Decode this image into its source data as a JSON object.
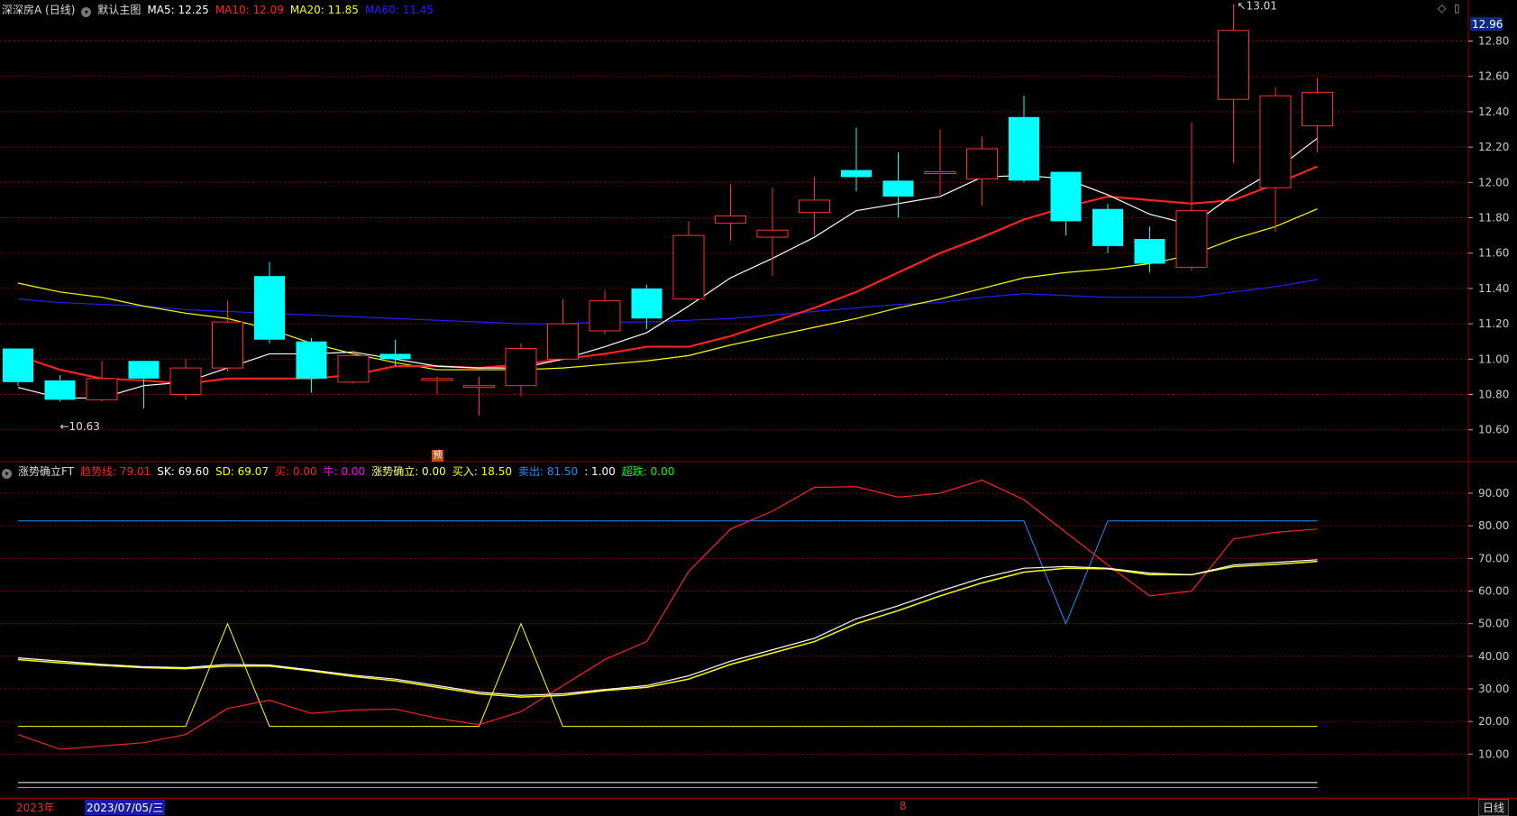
{
  "header": {
    "stock": "深深房A (日线)",
    "template": "默认主图",
    "ma": [
      {
        "label": "MA5: 12.25",
        "color": "#ffffff"
      },
      {
        "label": "MA10: 12.09",
        "color": "#ff2020"
      },
      {
        "label": "MA20: 11.85",
        "color": "#ffff00"
      },
      {
        "label": "MA60: 11.45",
        "color": "#2020ff"
      }
    ]
  },
  "indicator": {
    "name": "涨势确立FT",
    "items": [
      {
        "label": "趋势线: 79.01",
        "color": "#ff2020"
      },
      {
        "label": "SK: 69.60",
        "color": "#ffffff"
      },
      {
        "label": "SD: 69.07",
        "color": "#ffff00"
      },
      {
        "label": "买: 0.00",
        "color": "#ff2020"
      },
      {
        "label": "牛: 0.00",
        "color": "#ff00ff"
      },
      {
        "label": "涨势确立: 0.00",
        "color": "#ffff66"
      },
      {
        "label": "买入: 18.50",
        "color": "#ffff00"
      },
      {
        "label": "卖出: 81.50",
        "color": "#1e90ff"
      },
      {
        "label": ": 1.00",
        "color": "#ffffff"
      },
      {
        "label": "超跌: 0.00",
        "color": "#00ff00"
      }
    ]
  },
  "price_axis": {
    "ticks": [
      "12.80",
      "12.60",
      "12.40",
      "12.20",
      "12.00",
      "11.80",
      "11.60",
      "11.40",
      "11.20",
      "11.00",
      "10.80",
      "10.60"
    ],
    "current": "12.96",
    "high_label": "13.01",
    "low_label": "10.63"
  },
  "ind_axis": {
    "ticks": [
      "90.00",
      "80.00",
      "70.00",
      "60.00",
      "50.00",
      "40.00",
      "30.00",
      "20.00",
      "10.00"
    ]
  },
  "bottom": {
    "year": "2023年",
    "date": "2023/07/05/三",
    "month": "8",
    "period": "日线"
  },
  "marker": "预",
  "colors": {
    "up": "#ff3030",
    "down": "#00ffff",
    "grid": "#8b0000"
  },
  "chart_data": {
    "type": "candlestick",
    "candles": [
      {
        "o": 11.06,
        "h": 11.06,
        "l": 10.85,
        "c": 10.87
      },
      {
        "o": 10.88,
        "h": 10.91,
        "l": 10.76,
        "c": 10.77
      },
      {
        "o": 10.77,
        "h": 10.99,
        "l": 10.76,
        "c": 10.89
      },
      {
        "o": 10.99,
        "h": 10.99,
        "l": 10.72,
        "c": 10.89
      },
      {
        "o": 10.8,
        "h": 11.0,
        "l": 10.77,
        "c": 10.95
      },
      {
        "o": 10.95,
        "h": 11.33,
        "l": 10.93,
        "c": 11.21
      },
      {
        "o": 11.47,
        "h": 11.55,
        "l": 11.09,
        "c": 11.11
      },
      {
        "o": 11.1,
        "h": 11.12,
        "l": 10.81,
        "c": 10.89
      },
      {
        "o": 10.87,
        "h": 11.05,
        "l": 10.86,
        "c": 11.02
      },
      {
        "o": 11.03,
        "h": 11.11,
        "l": 10.96,
        "c": 11.0
      },
      {
        "o": 10.88,
        "h": 10.9,
        "l": 10.8,
        "c": 10.89
      },
      {
        "o": 10.84,
        "h": 10.9,
        "l": 10.68,
        "c": 10.85
      },
      {
        "o": 10.85,
        "h": 11.09,
        "l": 10.79,
        "c": 11.06
      },
      {
        "o": 11.0,
        "h": 11.34,
        "l": 11.0,
        "c": 11.2
      },
      {
        "o": 11.16,
        "h": 11.39,
        "l": 11.14,
        "c": 11.33
      },
      {
        "o": 11.4,
        "h": 11.42,
        "l": 11.17,
        "c": 11.23
      },
      {
        "o": 11.34,
        "h": 11.78,
        "l": 11.34,
        "c": 11.7
      },
      {
        "o": 11.77,
        "h": 11.99,
        "l": 11.67,
        "c": 11.81
      },
      {
        "o": 11.69,
        "h": 11.97,
        "l": 11.47,
        "c": 11.73
      },
      {
        "o": 11.83,
        "h": 12.03,
        "l": 11.7,
        "c": 11.9
      },
      {
        "o": 12.07,
        "h": 12.31,
        "l": 11.95,
        "c": 12.03
      },
      {
        "o": 12.01,
        "h": 12.17,
        "l": 11.8,
        "c": 11.92
      },
      {
        "o": 12.05,
        "h": 12.3,
        "l": 11.93,
        "c": 12.06
      },
      {
        "o": 12.02,
        "h": 12.26,
        "l": 11.87,
        "c": 12.19
      },
      {
        "o": 12.37,
        "h": 12.49,
        "l": 12.0,
        "c": 12.01
      },
      {
        "o": 12.06,
        "h": 12.06,
        "l": 11.7,
        "c": 11.78
      },
      {
        "o": 11.85,
        "h": 11.88,
        "l": 11.6,
        "c": 11.64
      },
      {
        "o": 11.68,
        "h": 11.75,
        "l": 11.49,
        "c": 11.54
      },
      {
        "o": 11.52,
        "h": 12.34,
        "l": 11.5,
        "c": 11.84
      },
      {
        "o": 12.47,
        "h": 13.01,
        "l": 12.11,
        "c": 12.86
      },
      {
        "o": 11.97,
        "h": 12.54,
        "l": 11.72,
        "c": 12.49
      },
      {
        "o": 12.32,
        "h": 12.59,
        "l": 12.17,
        "c": 12.51
      }
    ],
    "ma5": [
      10.84,
      10.78,
      10.78,
      10.85,
      10.87,
      10.95,
      11.03,
      11.03,
      11.04,
      11.0,
      10.96,
      10.95,
      10.95,
      11.0,
      11.07,
      11.15,
      11.3,
      11.46,
      11.57,
      11.69,
      11.84,
      11.88,
      11.92,
      12.03,
      12.04,
      12.02,
      11.93,
      11.82,
      11.76,
      11.93,
      12.07,
      12.25
    ],
    "ma10": [
      11.02,
      10.94,
      10.89,
      10.88,
      10.86,
      10.89,
      10.89,
      10.89,
      10.91,
      10.96,
      10.96,
      10.95,
      10.97,
      11.0,
      11.03,
      11.07,
      11.07,
      11.13,
      11.21,
      11.29,
      11.38,
      11.49,
      11.6,
      11.69,
      11.79,
      11.86,
      11.92,
      11.9,
      11.88,
      11.9,
      11.99,
      12.09
    ],
    "ma20": [
      11.43,
      11.38,
      11.35,
      11.3,
      11.26,
      11.23,
      11.17,
      11.09,
      11.03,
      10.98,
      10.94,
      10.94,
      10.94,
      10.95,
      10.97,
      10.99,
      11.02,
      11.08,
      11.13,
      11.18,
      11.23,
      11.29,
      11.34,
      11.4,
      11.46,
      11.49,
      11.51,
      11.54,
      11.59,
      11.68,
      11.75,
      11.85
    ],
    "ma60": [
      11.34,
      11.32,
      11.31,
      11.3,
      11.28,
      11.27,
      11.26,
      11.25,
      11.24,
      11.23,
      11.22,
      11.21,
      11.2,
      11.2,
      11.21,
      11.21,
      11.22,
      11.23,
      11.25,
      11.27,
      11.29,
      11.31,
      11.32,
      11.35,
      11.37,
      11.36,
      11.35,
      11.35,
      11.35,
      11.38,
      11.41,
      11.45
    ],
    "ind_trend": [
      16.0,
      11.5,
      12.5,
      13.5,
      16.0,
      24.0,
      26.5,
      22.5,
      23.5,
      23.8,
      21.0,
      19.0,
      23.0,
      31.0,
      39.0,
      44.5,
      66.0,
      79.0,
      84.5,
      91.8,
      92.0,
      88.8,
      90.0,
      94.0,
      88.0,
      78.0,
      68.0,
      58.5,
      60.0,
      76.0,
      78.0,
      79.0
    ],
    "ind_sk": [
      39.5,
      38.5,
      37.5,
      36.8,
      36.5,
      37.5,
      37.3,
      35.8,
      34.2,
      33.0,
      31.0,
      29.0,
      28.0,
      28.5,
      29.8,
      31.0,
      34.0,
      38.5,
      42.0,
      45.5,
      51.5,
      55.5,
      60.0,
      64.0,
      67.0,
      67.5,
      67.0,
      65.5,
      65.0,
      68.0,
      68.8,
      69.6
    ],
    "ind_sd": [
      39.0,
      38.0,
      37.2,
      36.5,
      36.2,
      37.0,
      37.0,
      35.5,
      33.8,
      32.5,
      30.5,
      28.5,
      27.5,
      28.0,
      29.5,
      30.5,
      33.0,
      37.5,
      41.0,
      44.5,
      50.0,
      54.0,
      58.5,
      62.5,
      65.8,
      67.0,
      66.8,
      65.0,
      65.0,
      67.5,
      68.2,
      69.1
    ],
    "ind_buy_line": [
      18.5,
      18.5,
      18.5,
      18.5,
      18.5,
      50.0,
      18.5,
      18.5,
      18.5,
      18.5,
      18.5,
      18.5,
      50.0,
      18.5,
      18.5,
      18.5,
      18.5,
      18.5,
      18.5,
      18.5,
      18.5,
      18.5,
      18.5,
      18.5,
      18.5,
      18.5,
      18.5,
      18.5,
      18.5,
      18.5,
      18.5,
      18.5
    ],
    "ind_sell_line": [
      81.5,
      81.5,
      81.5,
      81.5,
      81.5,
      81.5,
      81.5,
      81.5,
      81.5,
      81.5,
      81.5,
      81.5,
      81.5,
      81.5,
      81.5,
      81.5,
      81.5,
      81.5,
      81.5,
      81.5,
      81.5,
      81.5,
      81.5,
      81.5,
      81.5,
      50.0,
      81.5,
      81.5,
      81.5,
      81.5,
      81.5,
      81.5
    ],
    "ind_oversold": [
      0.0
    ],
    "ind_one": [
      1.0
    ]
  }
}
